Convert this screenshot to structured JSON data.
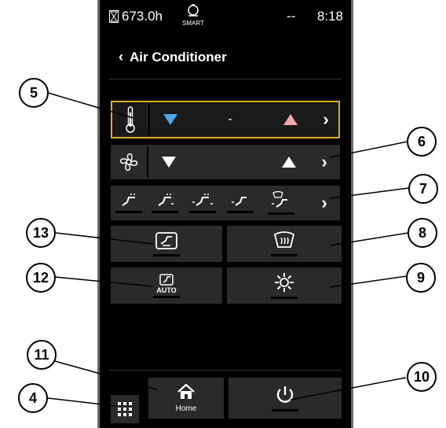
{
  "status": {
    "hours": "673.0h",
    "smart_label": "SMART",
    "dashes": "--",
    "time": "8:18"
  },
  "header": {
    "title": "Air Conditioner"
  },
  "temperature": {
    "value": "-"
  },
  "buttons": {
    "auto_label": "AUTO",
    "home_label": "Home"
  },
  "callouts": [
    "4",
    "5",
    "6",
    "7",
    "8",
    "9",
    "10",
    "11",
    "12",
    "13"
  ],
  "colors": {
    "accent": "#e3a82b",
    "temp_down": "#4da6e8",
    "temp_up": "#f4a6a6"
  }
}
